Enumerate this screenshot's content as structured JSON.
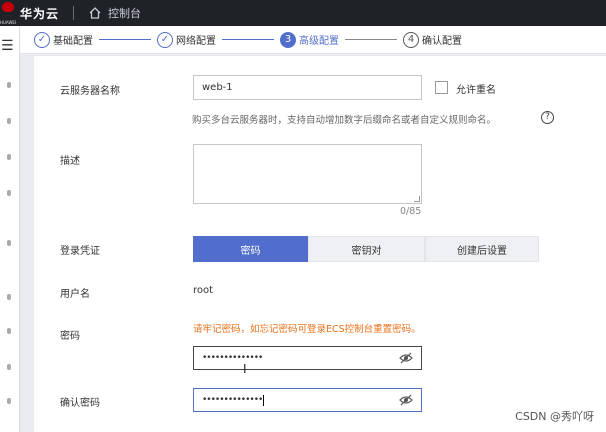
{
  "header": {
    "logo_text": "HUAWEI",
    "brand": "华为云",
    "console_label": "控制台"
  },
  "steps": [
    {
      "index": "1",
      "label": "基础配置",
      "state": "done"
    },
    {
      "index": "2",
      "label": "网络配置",
      "state": "done"
    },
    {
      "index": "3",
      "label": "高级配置",
      "state": "active"
    },
    {
      "index": "4",
      "label": "确认配置",
      "state": "todo"
    }
  ],
  "form": {
    "server_name": {
      "label": "云服务器名称",
      "value": "web-1",
      "allow_duplicate_label": "允许重名",
      "allow_duplicate_checked": false,
      "hint": "购买多台云服务器时，支持自动增加数字后缀命名或者自定义规则命名。"
    },
    "description": {
      "label": "描述",
      "value": "",
      "counter": "0/85"
    },
    "login": {
      "label": "登录凭证",
      "options": [
        "密码",
        "密钥对",
        "创建后设置"
      ],
      "selected": "密码"
    },
    "username": {
      "label": "用户名",
      "value": "root"
    },
    "password": {
      "label": "密码",
      "warning": "请牢记密码，如忘记密码可登录ECS控制台重置密码。",
      "masked": "••••••••••••••"
    },
    "confirm_password": {
      "label": "确认密码",
      "masked": "••••••••••••••"
    }
  },
  "watermark": "CSDN @秀吖呀",
  "colors": {
    "accent": "#526ecc",
    "warning": "#e8711a",
    "topbar": "#1f2227",
    "brand_red": "#c7000b"
  }
}
